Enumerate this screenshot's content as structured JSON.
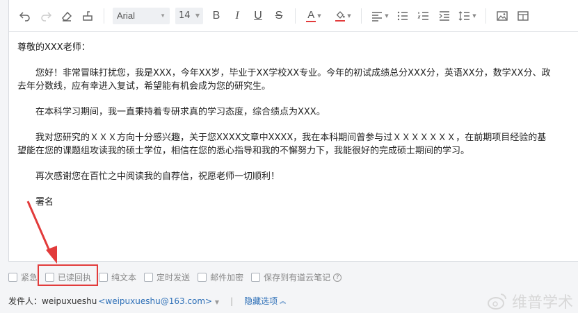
{
  "toolbar": {
    "font": "Arial",
    "size": "14",
    "bold": "B",
    "italic": "I",
    "underline": "U",
    "strike": "S",
    "font_color_letter": "A",
    "font_color": "#e23b3b",
    "highlight_color": "#e23b3b"
  },
  "letter": {
    "greeting": "尊敬的XXX老师：",
    "p1": "您好！非常冒昧打扰您，我是XXX，今年XX岁，毕业于XX学校XX专业。今年的初试成绩总分XXX分，英语XX分，数学XX分、政治XX分，专业课XX分，超过去年分数线，应有幸进入复试，希望能有机会成为您的研究生。",
    "p1_line1": "您好！非常冒昧打扰您，我是XXX，今年XX岁，毕业于XX学校XX专业。今年的初试成绩总分XXX分，英语XX分，数学XX分、政",
    "p1_line2": "去年分数线，应有幸进入复试，希望能有机会成为您的研究生。",
    "p2": "在本科学习期间，我一直秉持着专研求真的学习态度，综合绩点为XXX。",
    "p3_line1": "我对您研究的ＸＸＸ方向十分感兴趣，关于您XXXX文章中XXXX，我在本科期间曾参与过ＸＸＸＸＸＸＸ，在前期项目经验的基",
    "p3_line2": "望能在您的课题组攻读我的硕士学位，相信在您的悉心指导和我的不懈努力下，我能很好的完成硕士期间的学习。",
    "p4": "再次感谢您在百忙之中阅读我的自荐信，祝愿老师一切顺利！",
    "signature": "署名"
  },
  "options": {
    "urgent": "紧急",
    "read_receipt": "已读回执",
    "plain_text": "纯文本",
    "scheduled": "定时发送",
    "encrypt": "邮件加密",
    "save_note": "保存到有道云笔记",
    "help": "?"
  },
  "sender": {
    "label": "发件人：",
    "name": "weipuxueshu",
    "email": "<weipuxueshu@163.com>",
    "divider": "|",
    "hide_options": "隐藏选项"
  },
  "watermark": "维普学术"
}
